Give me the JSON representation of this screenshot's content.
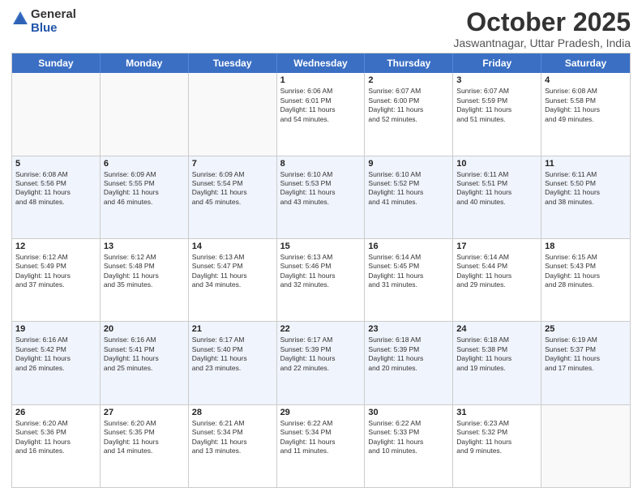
{
  "header": {
    "logo_general": "General",
    "logo_blue": "Blue",
    "month_title": "October 2025",
    "location": "Jaswantnagar, Uttar Pradesh, India"
  },
  "weekdays": [
    "Sunday",
    "Monday",
    "Tuesday",
    "Wednesday",
    "Thursday",
    "Friday",
    "Saturday"
  ],
  "rows": [
    [
      {
        "day": "",
        "info": ""
      },
      {
        "day": "",
        "info": ""
      },
      {
        "day": "",
        "info": ""
      },
      {
        "day": "1",
        "info": "Sunrise: 6:06 AM\nSunset: 6:01 PM\nDaylight: 11 hours\nand 54 minutes."
      },
      {
        "day": "2",
        "info": "Sunrise: 6:07 AM\nSunset: 6:00 PM\nDaylight: 11 hours\nand 52 minutes."
      },
      {
        "day": "3",
        "info": "Sunrise: 6:07 AM\nSunset: 5:59 PM\nDaylight: 11 hours\nand 51 minutes."
      },
      {
        "day": "4",
        "info": "Sunrise: 6:08 AM\nSunset: 5:58 PM\nDaylight: 11 hours\nand 49 minutes."
      }
    ],
    [
      {
        "day": "5",
        "info": "Sunrise: 6:08 AM\nSunset: 5:56 PM\nDaylight: 11 hours\nand 48 minutes."
      },
      {
        "day": "6",
        "info": "Sunrise: 6:09 AM\nSunset: 5:55 PM\nDaylight: 11 hours\nand 46 minutes."
      },
      {
        "day": "7",
        "info": "Sunrise: 6:09 AM\nSunset: 5:54 PM\nDaylight: 11 hours\nand 45 minutes."
      },
      {
        "day": "8",
        "info": "Sunrise: 6:10 AM\nSunset: 5:53 PM\nDaylight: 11 hours\nand 43 minutes."
      },
      {
        "day": "9",
        "info": "Sunrise: 6:10 AM\nSunset: 5:52 PM\nDaylight: 11 hours\nand 41 minutes."
      },
      {
        "day": "10",
        "info": "Sunrise: 6:11 AM\nSunset: 5:51 PM\nDaylight: 11 hours\nand 40 minutes."
      },
      {
        "day": "11",
        "info": "Sunrise: 6:11 AM\nSunset: 5:50 PM\nDaylight: 11 hours\nand 38 minutes."
      }
    ],
    [
      {
        "day": "12",
        "info": "Sunrise: 6:12 AM\nSunset: 5:49 PM\nDaylight: 11 hours\nand 37 minutes."
      },
      {
        "day": "13",
        "info": "Sunrise: 6:12 AM\nSunset: 5:48 PM\nDaylight: 11 hours\nand 35 minutes."
      },
      {
        "day": "14",
        "info": "Sunrise: 6:13 AM\nSunset: 5:47 PM\nDaylight: 11 hours\nand 34 minutes."
      },
      {
        "day": "15",
        "info": "Sunrise: 6:13 AM\nSunset: 5:46 PM\nDaylight: 11 hours\nand 32 minutes."
      },
      {
        "day": "16",
        "info": "Sunrise: 6:14 AM\nSunset: 5:45 PM\nDaylight: 11 hours\nand 31 minutes."
      },
      {
        "day": "17",
        "info": "Sunrise: 6:14 AM\nSunset: 5:44 PM\nDaylight: 11 hours\nand 29 minutes."
      },
      {
        "day": "18",
        "info": "Sunrise: 6:15 AM\nSunset: 5:43 PM\nDaylight: 11 hours\nand 28 minutes."
      }
    ],
    [
      {
        "day": "19",
        "info": "Sunrise: 6:16 AM\nSunset: 5:42 PM\nDaylight: 11 hours\nand 26 minutes."
      },
      {
        "day": "20",
        "info": "Sunrise: 6:16 AM\nSunset: 5:41 PM\nDaylight: 11 hours\nand 25 minutes."
      },
      {
        "day": "21",
        "info": "Sunrise: 6:17 AM\nSunset: 5:40 PM\nDaylight: 11 hours\nand 23 minutes."
      },
      {
        "day": "22",
        "info": "Sunrise: 6:17 AM\nSunset: 5:39 PM\nDaylight: 11 hours\nand 22 minutes."
      },
      {
        "day": "23",
        "info": "Sunrise: 6:18 AM\nSunset: 5:39 PM\nDaylight: 11 hours\nand 20 minutes."
      },
      {
        "day": "24",
        "info": "Sunrise: 6:18 AM\nSunset: 5:38 PM\nDaylight: 11 hours\nand 19 minutes."
      },
      {
        "day": "25",
        "info": "Sunrise: 6:19 AM\nSunset: 5:37 PM\nDaylight: 11 hours\nand 17 minutes."
      }
    ],
    [
      {
        "day": "26",
        "info": "Sunrise: 6:20 AM\nSunset: 5:36 PM\nDaylight: 11 hours\nand 16 minutes."
      },
      {
        "day": "27",
        "info": "Sunrise: 6:20 AM\nSunset: 5:35 PM\nDaylight: 11 hours\nand 14 minutes."
      },
      {
        "day": "28",
        "info": "Sunrise: 6:21 AM\nSunset: 5:34 PM\nDaylight: 11 hours\nand 13 minutes."
      },
      {
        "day": "29",
        "info": "Sunrise: 6:22 AM\nSunset: 5:34 PM\nDaylight: 11 hours\nand 11 minutes."
      },
      {
        "day": "30",
        "info": "Sunrise: 6:22 AM\nSunset: 5:33 PM\nDaylight: 11 hours\nand 10 minutes."
      },
      {
        "day": "31",
        "info": "Sunrise: 6:23 AM\nSunset: 5:32 PM\nDaylight: 11 hours\nand 9 minutes."
      },
      {
        "day": "",
        "info": ""
      }
    ]
  ]
}
